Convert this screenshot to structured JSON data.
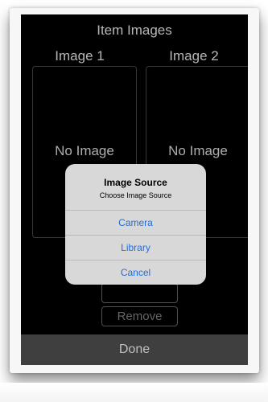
{
  "header": {
    "title": "Item Images"
  },
  "columns": [
    {
      "label": "Image 1",
      "placeholder": "No Image"
    },
    {
      "label": "Image 2",
      "placeholder": "No Image"
    }
  ],
  "actions": {
    "remove_label": "Remove"
  },
  "footer": {
    "done_label": "Done"
  },
  "alert": {
    "title": "Image Source",
    "message": "Choose Image Source",
    "buttons": [
      "Camera",
      "Library",
      "Cancel"
    ]
  },
  "colors": {
    "screen_background": "#000000",
    "done_bar": "#545454",
    "alert_background": "#dfdfdf",
    "alert_button_text": "#1e6fe0"
  }
}
